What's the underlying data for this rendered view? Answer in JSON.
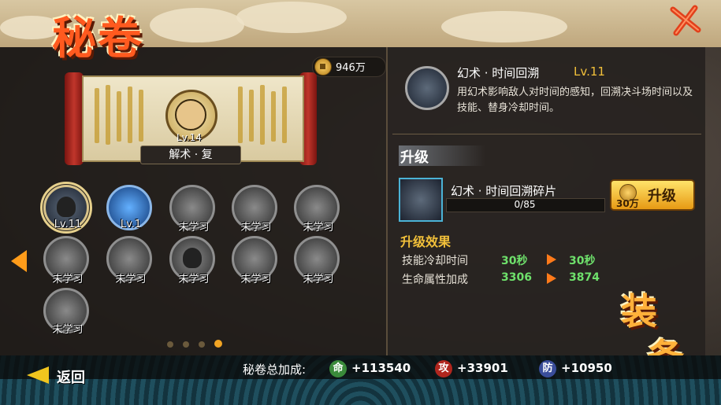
{
  "title": "秘卷",
  "coins": "946万",
  "scroll": {
    "level": "Lv.14",
    "caption": "解术 · 复"
  },
  "skills": [
    {
      "label": "Lv.11",
      "state": "learned",
      "selected": true
    },
    {
      "label": "Lv.1",
      "state": "learned",
      "selected": false
    },
    {
      "label": "未学习",
      "state": "locked"
    },
    {
      "label": "未学习",
      "state": "locked"
    },
    {
      "label": "未学习",
      "state": "locked"
    },
    {
      "label": "未学习",
      "state": "locked"
    },
    {
      "label": "未学习",
      "state": "locked"
    },
    {
      "label": "未学习",
      "state": "locked"
    },
    {
      "label": "未学习",
      "state": "locked"
    },
    {
      "label": "未学习",
      "state": "locked"
    },
    {
      "label": "未学习",
      "state": "locked"
    }
  ],
  "page_dots": {
    "count": 4,
    "active": 4
  },
  "detail": {
    "name": "幻术 · 时间回溯",
    "level": "Lv.11",
    "description": "用幻术影响敌人对时间的感知，回溯决斗场时间以及技能、替身冷却时间。"
  },
  "upgrade": {
    "tab_label": "升级",
    "fragment_name": "幻术 · 时间回溯碎片",
    "fragment_count": "0/85",
    "fragment_progress": 0.0,
    "button_label": "升级",
    "button_cost": "30万",
    "effect_title": "升级效果",
    "stats": [
      {
        "label": "技能冷却时间",
        "old": "30秒",
        "new": "30秒"
      },
      {
        "label": "生命属性加成",
        "old": "3306",
        "new": "3874"
      }
    ]
  },
  "equip_label": [
    "装",
    "备"
  ],
  "bottom": {
    "back_label": "返回",
    "total_label": "秘卷总加成:",
    "attrs": [
      {
        "badge": "命",
        "value": "+113540",
        "color": "#3a8a3a"
      },
      {
        "badge": "攻",
        "value": "+33901",
        "color": "#b0261e"
      },
      {
        "badge": "防",
        "value": "+10950",
        "color": "#3a4d9a"
      }
    ]
  },
  "colors": {
    "accent": "#f2c03a",
    "positive": "#6ee06b",
    "title": "#ff5a1f"
  }
}
